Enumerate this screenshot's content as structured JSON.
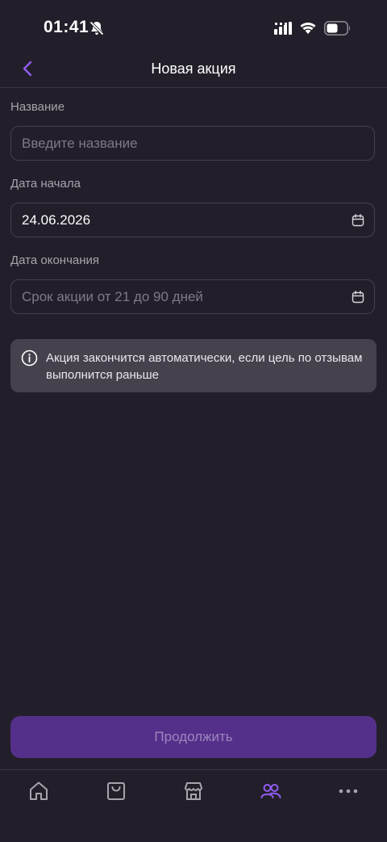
{
  "status_bar": {
    "time": "01:41"
  },
  "header": {
    "title": "Новая акция"
  },
  "form": {
    "name": {
      "label": "Название",
      "placeholder": "Введите название",
      "value": ""
    },
    "start_date": {
      "label": "Дата начала",
      "value": "24.06.2026"
    },
    "end_date": {
      "label": "Дата окончания",
      "placeholder": "Срок акции от 21 до 90 дней",
      "value": ""
    }
  },
  "info": {
    "text": "Акция закончится автоматически, если цель по отзывам выполнится раньше"
  },
  "continue_button": {
    "label": "Продолжить"
  },
  "bottom_nav": {
    "items": [
      {
        "icon": "home-icon",
        "active": false
      },
      {
        "icon": "bag-icon",
        "active": false
      },
      {
        "icon": "store-icon",
        "active": false
      },
      {
        "icon": "users-icon",
        "active": true
      },
      {
        "icon": "more-icon",
        "active": false
      }
    ]
  },
  "colors": {
    "background": "#231f2a",
    "accent": "#8f5cf0",
    "button_disabled": "#55308a",
    "info_background": "#45424d"
  }
}
